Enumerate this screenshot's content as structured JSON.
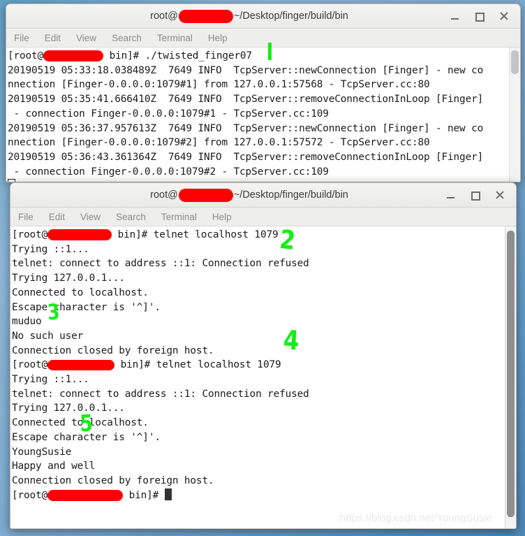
{
  "desktop": {
    "watermark": "https://blog.csdn.net/YoungSusie"
  },
  "menu": {
    "items": [
      "File",
      "Edit",
      "View",
      "Search",
      "Terminal",
      "Help"
    ]
  },
  "window_controls": {
    "minimize": "minimize-icon",
    "maximize": "maximize-icon",
    "close": "close-icon"
  },
  "window_top": {
    "title_prefix": "root@",
    "title_suffix": "~/Desktop/finger/build/bin",
    "terminal_lines": [
      {
        "pre": "[root@",
        "post": " bin]# ./twisted_finger07"
      },
      {
        "text": "20190519 05:33:18.038489Z  7649 INFO  TcpServer::newConnection [Finger] - new co"
      },
      {
        "text": "nnection [Finger-0.0.0.0:1079#1] from 127.0.0.1:57568 - TcpServer.cc:80"
      },
      {
        "text": "20190519 05:35:41.666410Z  7649 INFO  TcpServer::removeConnectionInLoop [Finger]"
      },
      {
        "text": " - connection Finger-0.0.0.0:1079#1 - TcpServer.cc:109"
      },
      {
        "text": "20190519 05:36:37.957613Z  7649 INFO  TcpServer::newConnection [Finger] - new co"
      },
      {
        "text": "nnection [Finger-0.0.0.0:1079#2] from 127.0.0.1:57572 - TcpServer.cc:80"
      },
      {
        "text": "20190519 05:36:43.361364Z  7649 INFO  TcpServer::removeConnectionInLoop [Finger]"
      },
      {
        "text": " - connection Finger-0.0.0.0:1079#2 - TcpServer.cc:109"
      }
    ]
  },
  "window_bottom": {
    "title_prefix": "root@",
    "title_suffix": "~/Desktop/finger/build/bin",
    "terminal_lines": [
      {
        "pre": "[root@",
        "post": " bin]# telnet localhost 1079"
      },
      {
        "text": "Trying ::1..."
      },
      {
        "text": "telnet: connect to address ::1: Connection refused"
      },
      {
        "text": "Trying 127.0.0.1..."
      },
      {
        "text": "Connected to localhost."
      },
      {
        "text": "Escape character is '^]'."
      },
      {
        "text": "muduo"
      },
      {
        "text": "No such user"
      },
      {
        "text": "Connection closed by foreign host."
      },
      {
        "pre": "[root@",
        "post": " bin]# telnet localhost 1079"
      },
      {
        "text": "Trying ::1..."
      },
      {
        "text": "telnet: connect to address ::1: Connection refused"
      },
      {
        "text": "Trying 127.0.0.1..."
      },
      {
        "text": "Connected to localhost."
      },
      {
        "text": "Escape character is '^]'."
      },
      {
        "text": "YoungSusie"
      },
      {
        "text": "Happy and well"
      },
      {
        "text": "Connection closed by foreign host."
      },
      {
        "pre": "[root@",
        "post": " bin]# "
      }
    ]
  },
  "annotations": [
    {
      "label": "1"
    },
    {
      "label": "2"
    },
    {
      "label": "3"
    },
    {
      "label": "4"
    },
    {
      "label": "5"
    }
  ],
  "colors": {
    "annotation_green": "#13ef13",
    "redaction_red": "#fe0000",
    "desktop_blue": "#6a9fc8"
  }
}
